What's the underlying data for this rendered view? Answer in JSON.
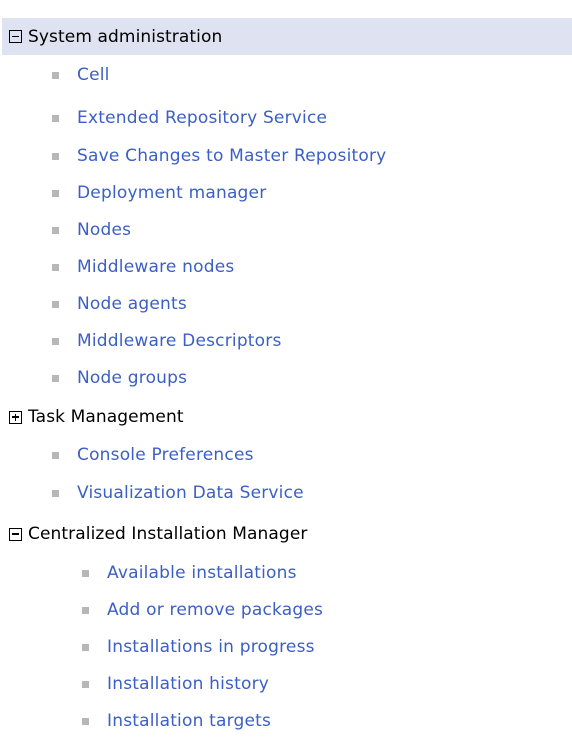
{
  "nav": {
    "system_admin": {
      "label": "System administration",
      "items": [
        {
          "label": "Cell"
        },
        {
          "label": "Extended Repository Service"
        },
        {
          "label": "Save Changes to Master Repository"
        },
        {
          "label": "Deployment manager"
        },
        {
          "label": "Nodes"
        },
        {
          "label": "Middleware nodes"
        },
        {
          "label": "Node agents"
        },
        {
          "label": "Middleware Descriptors"
        },
        {
          "label": "Node groups"
        }
      ],
      "task_management": {
        "label": "Task Management",
        "state": "collapsed"
      },
      "items_after": [
        {
          "label": "Console Preferences"
        },
        {
          "label": "Visualization Data Service"
        }
      ],
      "cim": {
        "label": "Centralized Installation Manager",
        "state": "expanded",
        "items": [
          {
            "label": "Available installations"
          },
          {
            "label": "Add or remove packages"
          },
          {
            "label": "Installations in progress"
          },
          {
            "label": "Installation history"
          },
          {
            "label": "Installation targets"
          }
        ]
      }
    }
  },
  "icons": {
    "expanded": "minus-box-icon",
    "collapsed": "plus-box-icon",
    "bullet": "square-bullet-icon"
  },
  "colors": {
    "header_bg": "#dfe3f1",
    "link": "#3b5fc4",
    "bullet": "#b7b7b7",
    "text": "#000000"
  }
}
